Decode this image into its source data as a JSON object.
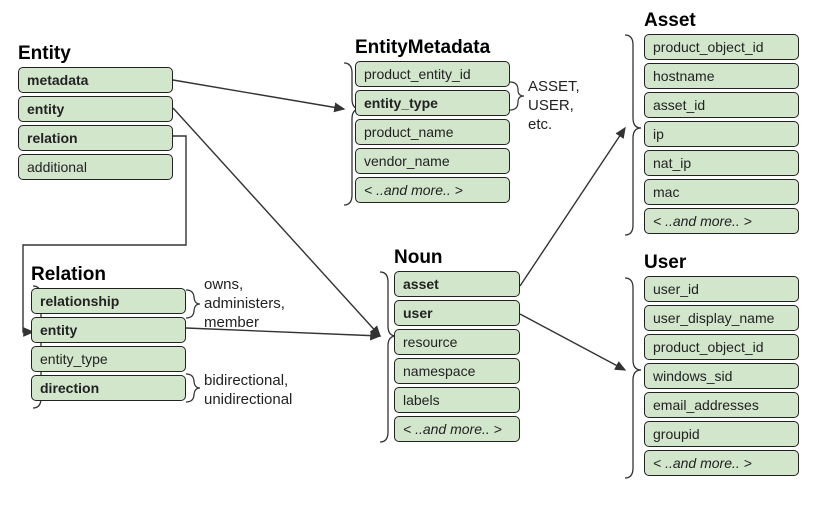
{
  "entities": {
    "entity": {
      "title": "Entity",
      "rows": [
        {
          "label": "metadata",
          "bold": true
        },
        {
          "label": "entity",
          "bold": true
        },
        {
          "label": "relation",
          "bold": true
        },
        {
          "label": "additional",
          "bold": false
        }
      ]
    },
    "entityMetadata": {
      "title": "EntityMetadata",
      "rows": [
        {
          "label": "product_entity_id",
          "bold": false
        },
        {
          "label": "entity_type",
          "bold": true
        },
        {
          "label": "product_name",
          "bold": false
        },
        {
          "label": "vendor_name",
          "bold": false
        },
        {
          "label": "< ..and more.. >",
          "bold": false,
          "more": true
        }
      ]
    },
    "asset": {
      "title": "Asset",
      "rows": [
        {
          "label": "product_object_id",
          "bold": false
        },
        {
          "label": "hostname",
          "bold": false
        },
        {
          "label": "asset_id",
          "bold": false
        },
        {
          "label": "ip",
          "bold": false
        },
        {
          "label": "nat_ip",
          "bold": false
        },
        {
          "label": "mac",
          "bold": false
        },
        {
          "label": "< ..and more.. >",
          "bold": false,
          "more": true
        }
      ]
    },
    "relation": {
      "title": "Relation",
      "rows": [
        {
          "label": "relationship",
          "bold": true
        },
        {
          "label": "entity",
          "bold": true
        },
        {
          "label": "entity_type",
          "bold": false
        },
        {
          "label": "direction",
          "bold": true
        }
      ]
    },
    "noun": {
      "title": "Noun",
      "rows": [
        {
          "label": "asset",
          "bold": true
        },
        {
          "label": "user",
          "bold": true
        },
        {
          "label": "resource",
          "bold": false
        },
        {
          "label": "namespace",
          "bold": false
        },
        {
          "label": "labels",
          "bold": false
        },
        {
          "label": "< ..and more.. >",
          "bold": false,
          "more": true
        }
      ]
    },
    "user": {
      "title": "User",
      "rows": [
        {
          "label": "user_id",
          "bold": false
        },
        {
          "label": "user_display_name",
          "bold": false
        },
        {
          "label": "product_object_id",
          "bold": false
        },
        {
          "label": "windows_sid",
          "bold": false
        },
        {
          "label": "email_addresses",
          "bold": false
        },
        {
          "label": "groupid",
          "bold": false
        },
        {
          "label": "< ..and more.. >",
          "bold": false,
          "more": true
        }
      ]
    }
  },
  "annotations": {
    "entityType": "ASSET,\nUSER,\netc.",
    "relationship": "owns,\nadministers,\nmember",
    "direction": "bidirectional,\nunidirectional"
  }
}
